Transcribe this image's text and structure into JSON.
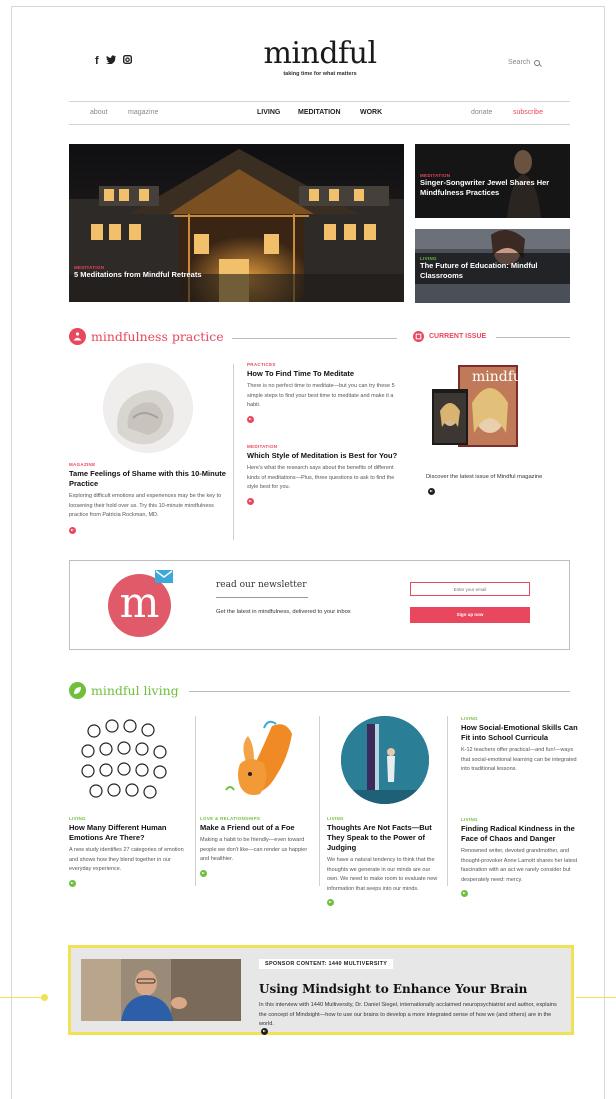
{
  "header": {
    "social": [
      "f",
      "𝕪",
      "◘"
    ],
    "logo": "mindful",
    "tagline": "taking time for what matters",
    "search": "Search"
  },
  "nav": {
    "about": "about",
    "magazine": "magazine",
    "living": "LIVING",
    "meditation": "MEDITATION",
    "work": "WORK",
    "donate": "donate",
    "subscribe": "subscribe"
  },
  "hero": {
    "category": "MEDITATION",
    "title": "5 Meditations from Mindful Retreats"
  },
  "side_tiles": [
    {
      "category": "MEDITATION",
      "title": "Singer-Songwriter Jewel Shares Her Mindfulness Practices"
    },
    {
      "category": "LIVING",
      "title": "The Future of Education: Mindful Classrooms"
    }
  ],
  "practice": {
    "heading": "mindfulness practice",
    "feature": {
      "category": "MAGAZINE",
      "title": "Tame Feelings of Shame with this 10-Minute Practice",
      "body": "Exploring difficult emotions and experiences may be the key to loosening their hold over us. Try this 10-minute mindfulness practice from Patricia Rockman, MD."
    },
    "articles": [
      {
        "category": "PRACTICES",
        "title": "How To Find Time To Meditate",
        "body": "There is no perfect time to meditate—but you can try these 5 simple steps to find your best time to meditate and make it a habit."
      },
      {
        "category": "MEDITATION",
        "title": "Which Style of Meditation is Best for You?",
        "body": "Here's what the research says about the benefits of different kinds of meditations—Plus, three questions to ask to find the style best for you."
      }
    ]
  },
  "current_issue": {
    "heading": "CURRENT ISSUE",
    "cover_title": "mindful",
    "text": "Discover the latest issue of Mindful magazine"
  },
  "newsletter": {
    "logo_letter": "m",
    "heading": "read our newsletter",
    "text": "Get the latest in mindfulness, delivered to your inbox",
    "placeholder": "Enter your email",
    "button": "Sign up now"
  },
  "living": {
    "heading": "mindful living",
    "cards": [
      {
        "category": "LIVING",
        "title": "How Many Different Human Emotions Are There?",
        "body": "A new study identifies 27 categories of emotion and shows how they blend together in our everyday experience."
      },
      {
        "category": "LOVE & RELATIONSHIPS",
        "title": "Make a Friend out of a Foe",
        "body": "Making a habit to be friendly—even toward people we don't like—can render us happier and healthier."
      },
      {
        "category": "LIVING",
        "title": "Thoughts Are Not Facts—But They Speak to the Power of Judging",
        "body": "We have a natural tendency to think that the thoughts we generate in our minds are our own. We need to make room to evaluate new information that seeps into our minds."
      }
    ],
    "side": [
      {
        "category": "LIVING",
        "title": "How Social-Emotional Skills Can Fit into School Curricula",
        "body": "K-12 teachers offer practical—and fun!—ways that social-emotional learning can be integrated into traditional lessons."
      },
      {
        "category": "LIVING",
        "title": "Finding Radical Kindness in the Face of Chaos and Danger",
        "body": "Renowned writer, devoted grandmother, and thought-provoker Anne Lamott shares her latest fascination with an act we rarely consider but desperately need: mercy."
      }
    ]
  },
  "sponsor": {
    "label": "SPONSOR CONTENT: 1440 MULTIVERSITY",
    "title": "Using Mindsight to Enhance Your Brain",
    "body": "In this interview with 1440 Multiversity, Dr. Daniel Siegel, internationally acclaimed neuropsychiatrist and author, explains the concept of Mindsight—how to use our brains to develop a more integrated sense of how we (and others) are in the world."
  },
  "colors": {
    "accent": "#e8475d",
    "living": "#6fbf3c",
    "sponsor_border": "#f1e255"
  }
}
